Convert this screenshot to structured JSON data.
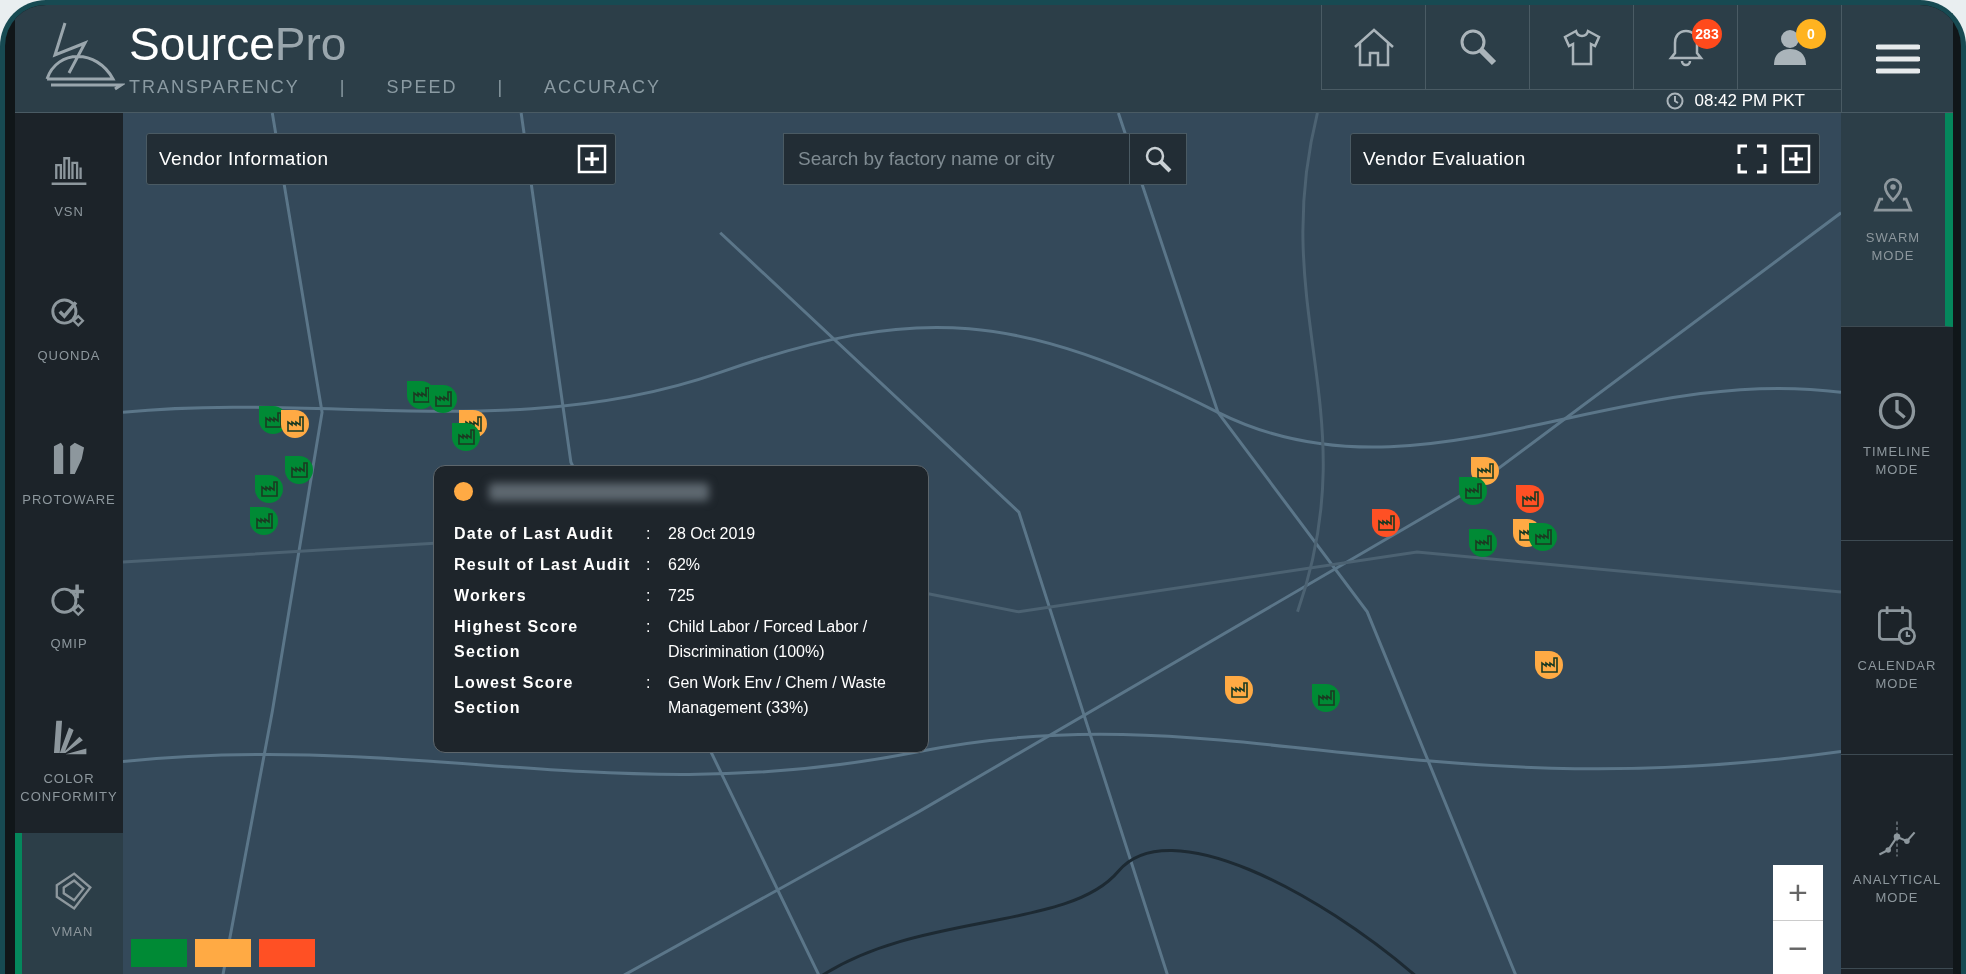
{
  "header": {
    "brand_primary": "Source",
    "brand_secondary": "Pro",
    "tagline": [
      "TRANSPARENCY",
      "|",
      "SPEED",
      "|",
      "ACCURACY"
    ],
    "notifications": {
      "count": "283"
    },
    "profile": {
      "count": "0"
    },
    "time": "08:42 PM PKT"
  },
  "left_nav": [
    {
      "label": "VSN",
      "selected": false
    },
    {
      "label": "QUONDA",
      "selected": false
    },
    {
      "label": "PROTOWARE",
      "selected": false
    },
    {
      "label": "QMIP",
      "selected": false
    },
    {
      "label": "COLOR CONFORMITY",
      "selected": false
    },
    {
      "label": "VMAN",
      "selected": true
    }
  ],
  "right_nav": [
    {
      "label": "SWARM MODE",
      "selected": true
    },
    {
      "label": "TIMELINE MODE",
      "selected": false
    },
    {
      "label": "CALENDAR MODE",
      "selected": false
    },
    {
      "label": "ANALYTICAL MODE",
      "selected": false
    }
  ],
  "vendor_information": {
    "title": "Vendor Information"
  },
  "search": {
    "placeholder": "Search by factory name or city"
  },
  "vendor_evaluation": {
    "title": "Vendor Evaluation"
  },
  "markers": [
    {
      "color": "#008a35"
    },
    {
      "color": "#ffaa44"
    },
    {
      "color": "#008a35"
    },
    {
      "color": "#008a35"
    },
    {
      "color": "#008a35"
    },
    {
      "color": "#008a35"
    },
    {
      "color": "#008a35"
    },
    {
      "color": "#ffaa44"
    },
    {
      "color": "#008a35"
    },
    {
      "color": "#ffaa44"
    },
    {
      "color": "#008a35"
    },
    {
      "color": "#ff5024"
    },
    {
      "color": "#ff5024"
    },
    {
      "color": "#008a35"
    },
    {
      "color": "#ffaa44"
    },
    {
      "color": "#008a35"
    },
    {
      "color": "#ffaa44"
    },
    {
      "color": "#ffaa44"
    },
    {
      "color": "#008a35"
    }
  ],
  "tooltip": {
    "color": "#ffaa44",
    "rows": [
      {
        "label": "Date of Last Audit",
        "separator": ":",
        "value": "28 Oct 2019"
      },
      {
        "label": "Result of Last Audit",
        "separator": ":",
        "value": "62%"
      },
      {
        "label": "Workers",
        "separator": ":",
        "value": "725"
      },
      {
        "label": "Highest Score Section",
        "separator": ":",
        "value": "Child Labor / Forced Labor / Discrimination (100%)"
      },
      {
        "label": "Lowest Score Section",
        "separator": ":",
        "value": "Gen Work Env / Chem / Waste Management (33%)"
      }
    ]
  },
  "zoom": {
    "in": "+",
    "out": "−"
  },
  "legend": [
    {
      "color": "#008a35"
    },
    {
      "color": "#ffaa44"
    },
    {
      "color": "#ff5024"
    }
  ]
}
